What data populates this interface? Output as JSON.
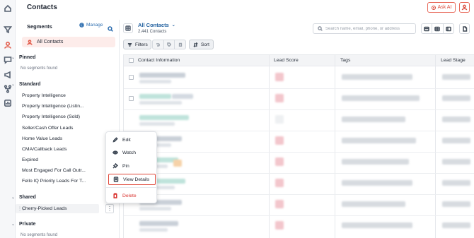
{
  "header": {
    "title": "Contacts",
    "ask_ai_label": "Ask AI"
  },
  "rail": {
    "icons": [
      "home-icon",
      "funnel-icon",
      "contacts-icon",
      "chat-icon",
      "megaphone-icon",
      "workflow-icon",
      "reports-icon"
    ]
  },
  "segments": {
    "heading": "Segments",
    "manage_label": "Manage",
    "all_contacts_label": "All Contacts",
    "groups": {
      "pinned": {
        "label": "Pinned",
        "empty": "No segments found"
      },
      "standard": {
        "label": "Standard",
        "items": [
          "Property Intelligence",
          "Property Intelligence (Listin...",
          "Property Intelligence (Sold)",
          "Seller/Cash Offer Leads",
          "Home Value Leads",
          "CMA/Callback Leads",
          "Expired",
          "Most Engaged For Call Outr...",
          "Fello IQ Priority Leads For T..."
        ]
      },
      "shared": {
        "label": "Shared",
        "items": [
          "Cherry-Picked Leads"
        ]
      },
      "private": {
        "label": "Private",
        "empty": "No segments found"
      }
    }
  },
  "view": {
    "name": "All Contacts",
    "count": "2,441 Contacts"
  },
  "search": {
    "placeholder": "Search name, email, phone, or address"
  },
  "toolbar": {
    "filters_label": "Filters",
    "sort_label": "Sort"
  },
  "table": {
    "columns": [
      "Contact Information",
      "Lead Score",
      "Tags",
      "Lead Stage"
    ]
  },
  "context_menu": {
    "items": [
      "Edit",
      "Watch",
      "Pin",
      "View Details",
      "Delete"
    ],
    "highlighted": "View Details"
  },
  "colors": {
    "accent": "#e25b4a",
    "link": "#1f5f9e",
    "danger": "#d9302c"
  }
}
